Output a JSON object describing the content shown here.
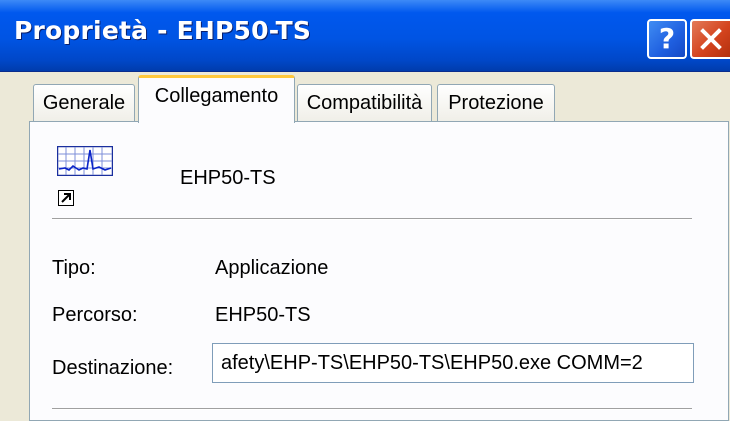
{
  "window": {
    "title": "Proprietà - EHP50-TS",
    "help_icon": "question-mark-icon",
    "close_icon": "close-x-icon"
  },
  "tabs": [
    {
      "label": "Generale",
      "active": false
    },
    {
      "label": "Collegamento",
      "active": true
    },
    {
      "label": "Compatibilità",
      "active": false
    },
    {
      "label": "Protezione",
      "active": false
    }
  ],
  "shortcut": {
    "name": "EHP50-TS",
    "icon": "application-chart-icon",
    "overlay_icon": "shortcut-arrow-icon"
  },
  "fields": {
    "tipo": {
      "label": "Tipo:",
      "value": "Applicazione"
    },
    "percorso": {
      "label": "Percorso:",
      "value": "EHP50-TS"
    },
    "destinazione": {
      "label": "Destinazione:",
      "value": "afety\\EHP-TS\\EHP50-TS\\EHP50.exe COMM=2"
    }
  },
  "colors": {
    "titlebar": "#0054e3",
    "active_tab_accent": "#ffc83c",
    "close_button": "#d4441e",
    "background": "#ece9d8"
  }
}
